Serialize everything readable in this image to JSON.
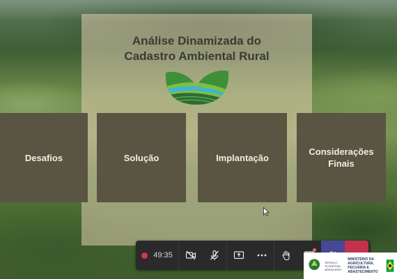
{
  "slide": {
    "title_line1": "Análise Dinamizada do",
    "title_line2": "Cadastro Ambiental Rural",
    "logo_icon": "car-logo-icon",
    "tiles": [
      {
        "label": "Desafios"
      },
      {
        "label": "Solução"
      },
      {
        "label": "Implantação"
      },
      {
        "label": "Considerações Finais"
      }
    ],
    "colors": {
      "tile_bg": "#5a5443",
      "tile_text": "#f1ede0",
      "panel_bg": "#decfb0",
      "title_text": "#3d3a30",
      "logo_green": "#3f8f3a",
      "logo_blue": "#3fb3d8"
    }
  },
  "toolbar": {
    "timer": "49:35",
    "recording_icon": "record-dot-icon",
    "buttons": [
      {
        "name": "camera-off-icon"
      },
      {
        "name": "mic-off-icon"
      },
      {
        "name": "share-screen-icon"
      },
      {
        "name": "more-icon"
      },
      {
        "name": "raise-hand-icon"
      },
      {
        "name": "chat-icon"
      },
      {
        "name": "participants-icon"
      },
      {
        "name": "hang-up-icon"
      }
    ],
    "colors": {
      "bar_bg": "#2a2a2c",
      "active_bg": "#474796",
      "hangup_bg": "#c4314b",
      "record": "#d4394a"
    }
  },
  "ministry_badge": {
    "sub": "SERVIÇO FLORESTAL BRASILEIRO",
    "name": "MINISTÉRIO DA AGRICULTURA, PECUÁRIA E ABASTECIMENTO"
  }
}
